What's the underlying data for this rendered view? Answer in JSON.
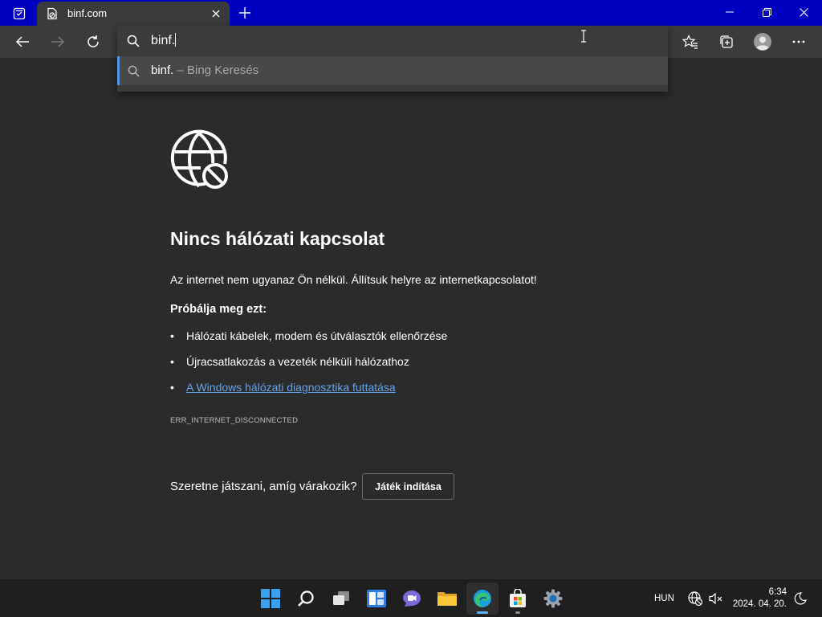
{
  "browser": {
    "tab": {
      "title": "binf.com"
    },
    "omnibox": {
      "input_value": "binf.",
      "suggestion": {
        "main": "binf.",
        "sub": " – Bing Keresés"
      }
    }
  },
  "page": {
    "heading": "Nincs hálózati kapcsolat",
    "description": "Az internet nem ugyanaz Ön nélkül. Állítsuk helyre az internetkapcsolatot!",
    "try_heading": "Próbálja meg ezt:",
    "suggestions": [
      "Hálózati kábelek, modem és útválasztók ellenőrzése",
      "Újracsatlakozás a vezeték nélküli hálózathoz"
    ],
    "diagnostics_link": "A Windows hálózati diagnosztika futtatása",
    "error_code": "ERR_INTERNET_DISCONNECTED",
    "game_question": "Szeretne játszani, amíg várakozik?",
    "game_button": "Játék indítása"
  },
  "taskbar": {
    "apps": [
      "start-icon",
      "search-icon",
      "task-view-icon",
      "widgets-icon",
      "chat-icon",
      "file-explorer-icon",
      "edge-icon",
      "store-icon",
      "settings-icon"
    ],
    "language": "HUN",
    "time": "6:34",
    "date": "2024. 04. 20."
  },
  "colors": {
    "titlebar": "#0000c0",
    "toolbar": "#3b3b3b",
    "page_bg": "#2b2b2b",
    "link": "#65a3ea",
    "suggest_accent": "#4f97e6"
  }
}
